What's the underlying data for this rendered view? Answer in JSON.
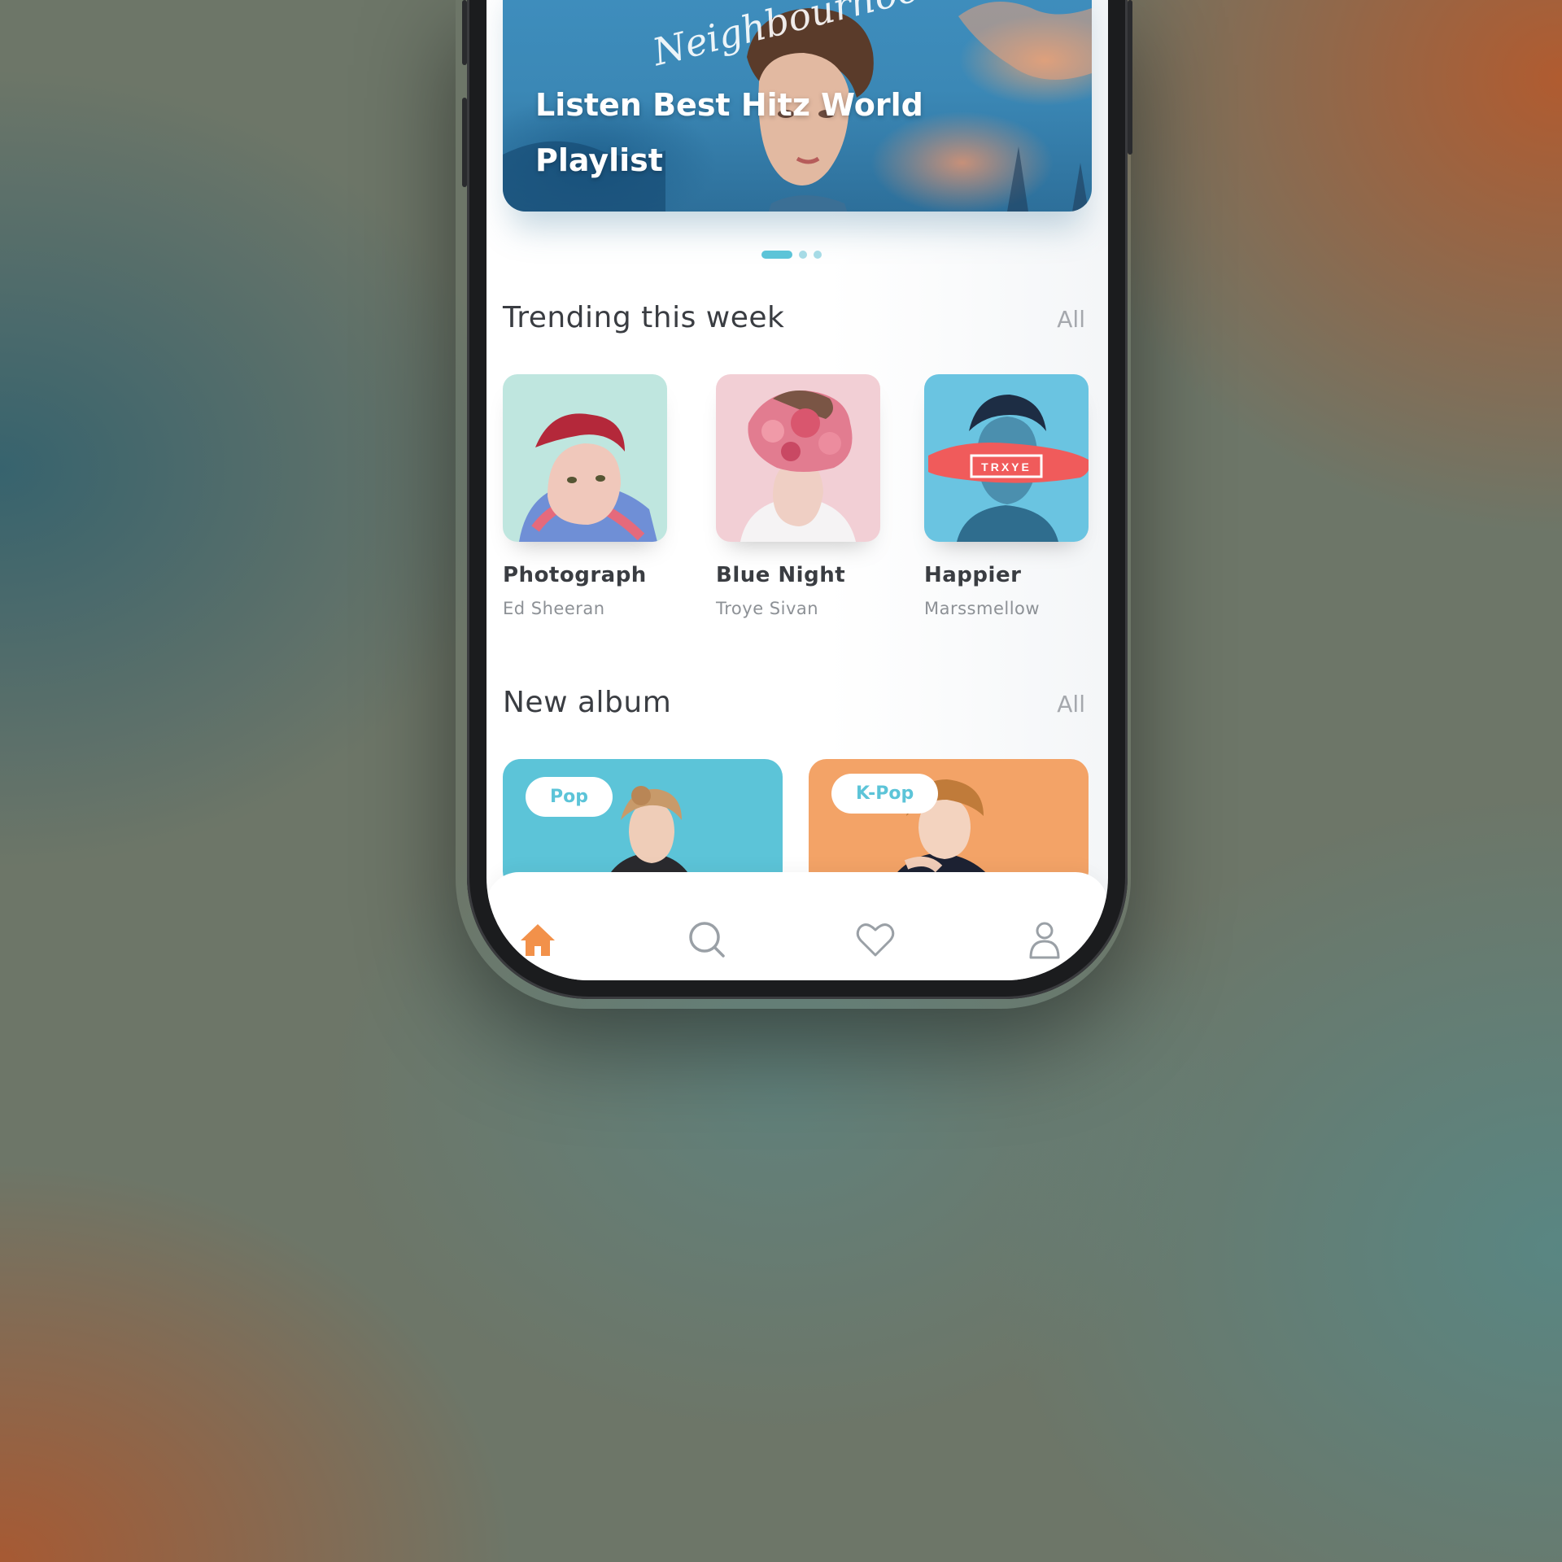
{
  "hero": {
    "title": "Listen Best Hitz World Playlist",
    "script_text": "Neighbourhood"
  },
  "carousel": {
    "pages": 3,
    "active_index": 0
  },
  "trending": {
    "title": "Trending this week",
    "all_label": "All",
    "items": [
      {
        "title": "Photograph",
        "artist": "Ed Sheeran",
        "art_color": "#bfe6df"
      },
      {
        "title": "Blue Night",
        "artist": "Troye Sivan",
        "art_color": "#f2cfd5"
      },
      {
        "title": "Happier",
        "artist": "Marssmellow",
        "art_color": "#6ac4e1",
        "art_text": "TRXYE"
      }
    ]
  },
  "new_album": {
    "title": "New album",
    "all_label": "All",
    "items": [
      {
        "genre": "Pop",
        "color": "#5cc4d8"
      },
      {
        "genre": "K-Pop",
        "color": "#f3a367"
      }
    ]
  },
  "tabbar": {
    "items": [
      "home-icon",
      "search-icon",
      "heart-icon",
      "profile-icon"
    ],
    "active": "home-icon",
    "active_color": "#f2914a",
    "inactive_color": "#9aa0a6"
  },
  "colors": {
    "accent": "#5cc4d8",
    "orange": "#f3a367"
  }
}
